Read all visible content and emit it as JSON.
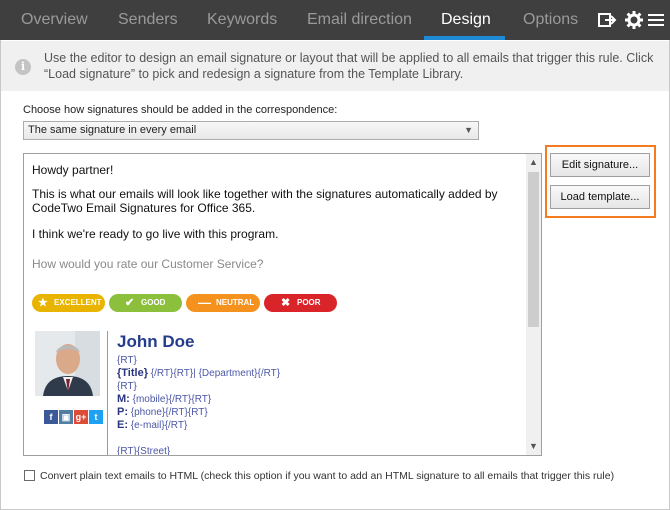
{
  "tabs": [
    {
      "label": "Overview",
      "active": false
    },
    {
      "label": "Senders",
      "active": false
    },
    {
      "label": "Keywords",
      "active": false
    },
    {
      "label": "Email direction",
      "active": false
    },
    {
      "label": "Design",
      "active": true
    },
    {
      "label": "Options",
      "active": false
    }
  ],
  "toolbar_icons": [
    "exit-icon",
    "gear-icon",
    "hamburger-menu-icon"
  ],
  "info": {
    "text": "Use the editor to design an email signature or layout that will be applied to all emails that trigger this rule. Click “Load signature” to pick and redesign a signature from the Template Library."
  },
  "signature_mode": {
    "label": "Choose how signatures should be added in the correspondence:",
    "selected": "The same signature in every email"
  },
  "preview": {
    "greeting": "Howdy partner!",
    "body": "This is what our emails will look like together with the signatures automatically added by CodeTwo Email Signatures for Office 365.",
    "closing": "I think we're ready to go live with this program.",
    "rating_question": "How would you rate our Customer Service?",
    "rating_buttons": [
      {
        "label": "EXCELLENT",
        "icon": "star-icon",
        "color": "#e8b400"
      },
      {
        "label": "GOOD",
        "icon": "check-icon",
        "color": "#8cc03c"
      },
      {
        "label": "NEUTRAL",
        "icon": "minus-icon",
        "color": "#f5921e"
      },
      {
        "label": "POOR",
        "icon": "x-icon",
        "color": "#d9242a"
      }
    ],
    "signature": {
      "name": "John Doe",
      "line1": "{RT}",
      "title_label": "{Title}",
      "title_rest": "{/RT}{RT}| {Department}{/RT}",
      "line3": "{RT}",
      "mobile_label": "M:",
      "mobile_value": "{mobile}{/RT}{RT}",
      "phone_label": "P:",
      "phone_value": "{phone}{/RT}{RT}",
      "email_label": "E:",
      "email_value": "{e-mail}{/RT}",
      "street": "{RT}{Street}",
      "social": [
        {
          "icon": "facebook-icon",
          "glyph": "f",
          "color": "#3b5998"
        },
        {
          "icon": "instagram-icon",
          "glyph": "▣",
          "color": "#517fa4"
        },
        {
          "icon": "google-plus-icon",
          "glyph": "g+",
          "color": "#dd4b39"
        },
        {
          "icon": "twitter-icon",
          "glyph": "t",
          "color": "#1da1f2"
        }
      ]
    }
  },
  "buttons": {
    "edit_signature": "Edit signature...",
    "load_template": "Load template..."
  },
  "convert_checkbox": {
    "checked": false,
    "label": "Convert plain text emails to HTML (check this option if you want to add an HTML signature to all emails that trigger this rule)"
  },
  "colors": {
    "tabbar_bg": "#3f3f3f",
    "tab_active_underline": "#1e8ad6",
    "highlight_border": "#f47b20",
    "signature_name": "#253c8c"
  }
}
